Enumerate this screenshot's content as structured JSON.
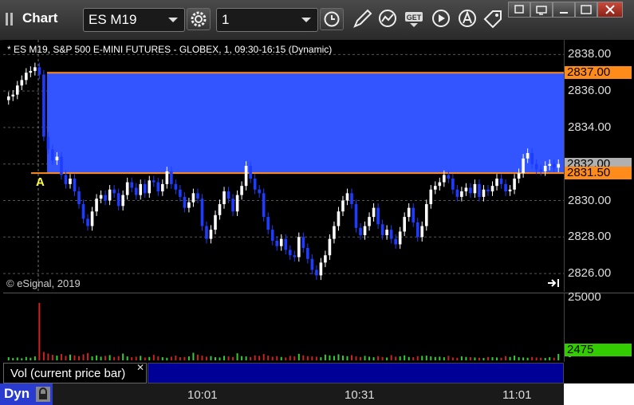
{
  "window": {
    "title": "Chart",
    "symbol": "ES M19",
    "interval": "1",
    "controls": {
      "pin_icon": "pin-icon",
      "restore_icon": "restore-icon",
      "minimize_icon": "minimize-icon",
      "maximize_icon": "maximize-icon",
      "close_icon": "close-icon"
    }
  },
  "toolbar": {
    "icons": [
      "settings-gear-icon",
      "clock-icon",
      "pencil-draw-icon",
      "study-line-icon",
      "get-data-icon",
      "play-icon",
      "alert-a-icon",
      "tag-icon"
    ],
    "get_label": "GET"
  },
  "chart": {
    "title": "* ES M19, S&P 500 E-MINI FUTURES - GLOBEX, 1, 09:30-16:15 (Dynamic)",
    "copyright": "© eSignal, 2019",
    "marker_label": "A",
    "price_labels": [
      "2838.00",
      "2836.00",
      "2834.00",
      "2832.00",
      "2830.00",
      "2828.00",
      "2826.00"
    ],
    "tags": {
      "upper_level": "2837.00",
      "current_price": "2832.00",
      "lower_level": "2831.50"
    },
    "colors": {
      "zone": "#3355ff",
      "level_line": "#ff8c1a",
      "up_candle": "#ffffff",
      "down_candle": "#1e3cff",
      "tag_bg": "#ff8c1a",
      "price_tag_bg": "#b0b0b0"
    }
  },
  "chart_data": {
    "type": "candlestick",
    "y_range": [
      2825.0,
      2838.8
    ],
    "zone": [
      2831.5,
      2837.0
    ],
    "closes": [
      2835.7,
      2835.8,
      2836.3,
      2836.6,
      2837.0,
      2837.1,
      2837.3,
      2836.9,
      2833.5,
      2832.8,
      2832.2,
      2832.4,
      2831.4,
      2830.9,
      2831.2,
      2830.5,
      2829.8,
      2829.0,
      2828.6,
      2829.4,
      2830.1,
      2830.3,
      2830.0,
      2830.6,
      2830.4,
      2829.7,
      2830.3,
      2831.0,
      2830.7,
      2830.3,
      2830.9,
      2830.4,
      2831.1,
      2831.0,
      2830.5,
      2830.9,
      2831.6,
      2830.9,
      2830.6,
      2830.2,
      2829.6,
      2829.9,
      2830.4,
      2830.1,
      2828.6,
      2827.9,
      2828.4,
      2829.2,
      2829.8,
      2830.5,
      2830.1,
      2829.4,
      2830.3,
      2830.8,
      2831.9,
      2831.2,
      2830.6,
      2830.4,
      2829.1,
      2828.4,
      2827.8,
      2827.5,
      2827.9,
      2827.3,
      2827.0,
      2826.9,
      2828.0,
      2827.4,
      2826.8,
      2826.2,
      2825.9,
      2826.6,
      2827.0,
      2827.9,
      2828.6,
      2829.4,
      2830.0,
      2830.4,
      2829.8,
      2828.5,
      2828.1,
      2828.6,
      2829.1,
      2829.6,
      2828.7,
      2828.1,
      2828.4,
      2827.9,
      2827.6,
      2828.3,
      2829.1,
      2829.6,
      2828.8,
      2828.0,
      2828.6,
      2829.8,
      2830.6,
      2830.8,
      2831.0,
      2831.4,
      2831.2,
      2830.6,
      2830.2,
      2830.5,
      2830.7,
      2830.4,
      2830.9,
      2830.2,
      2830.6,
      2830.5,
      2830.8,
      2831.2,
      2830.9,
      2830.5,
      2830.6,
      2831.2,
      2831.5,
      2832.3,
      2832.6,
      2832.0,
      2831.7,
      2831.6,
      2831.9,
      2832.0,
      2831.8,
      2832.0
    ]
  },
  "volume": {
    "label": "Vol (current price bar)",
    "scale_top": "25000",
    "scale_tag": "2475",
    "scale_bottom": "0",
    "colors": {
      "up": "#33cc33",
      "down": "#cc2222",
      "tag_bg": "#33cc00"
    },
    "values": [
      1200,
      900,
      1100,
      800,
      1300,
      1000,
      1500,
      22000,
      3200,
      2600,
      2100,
      1800,
      2400,
      1700,
      2200,
      1900,
      1600,
      2300,
      2800,
      1500,
      1900,
      1400,
      1700,
      2000,
      1300,
      1600,
      2600,
      1500,
      1200,
      1400,
      1700,
      1100,
      1300,
      2100,
      1500,
      1200,
      1000,
      1400,
      1800,
      1200,
      1300,
      1500,
      2900,
      2200,
      1800,
      1400,
      1600,
      1200,
      1100,
      1700,
      1500,
      1300,
      2700,
      1600,
      1500,
      1300,
      1900,
      1700,
      2400,
      1800,
      1400,
      1600,
      1300,
      1100,
      1700,
      1500,
      2500,
      1900,
      1600,
      1500,
      1400,
      1200,
      2200,
      1900,
      1700,
      2300,
      1800,
      1600,
      2000,
      1500,
      1300,
      1700,
      1400,
      1200,
      1600,
      1300,
      1100,
      2000,
      1400,
      1500,
      1900,
      1300,
      1200,
      1600,
      1700,
      1800,
      1500,
      1300,
      1400,
      1200,
      1700,
      1100,
      1000,
      1500,
      1300,
      1200,
      1100,
      1000,
      900,
      1300,
      1200,
      1100,
      1000,
      1600,
      1300,
      1800,
      1200,
      1100,
      1000,
      1300,
      1100,
      1000,
      900,
      1200,
      1000,
      2475
    ]
  },
  "time_axis": {
    "labels": [
      "10:01",
      "10:31",
      "11:01"
    ],
    "mode": "Dyn",
    "lock_icon": "lock-icon"
  }
}
